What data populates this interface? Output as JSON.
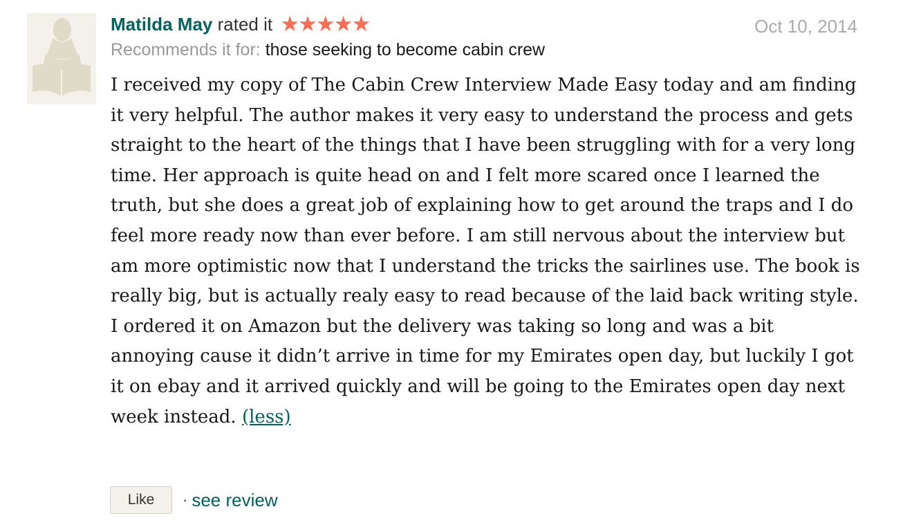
{
  "review": {
    "reviewer_name": "Matilda May",
    "rated_text": "rated it",
    "rating": 5,
    "rating_max": 5,
    "stars_display": "★★★★★",
    "date": "Oct 10, 2014",
    "recommends_label": "Recommends it for:",
    "recommends_value": "those seeking to become cabin crew",
    "body": "I received my copy of The Cabin Crew Interview Made Easy today and am finding it very helpful. The author makes it very easy to understand the process and gets straight to the heart of the things that I have been struggling with for a very long time. Her approach is quite head on and I felt more scared once I learned the truth, but she does a great job of explaining how to get around the traps and I do feel more ready now than ever before. I am still nervous about the interview but am more optimistic now that I understand the tricks the sairlines use. The book is really big, but is actually realy easy to read because of the laid back writing style. I ordered it on Amazon but the delivery was taking so long and was a bit annoying cause it didn’t arrive in time for my Emirates open day, but luckily I got it on ebay and it arrived quickly and will be going to the Emirates open day next week instead.",
    "less_label": "(less)",
    "like_label": "Like",
    "separator": "·",
    "see_review_label": "see review",
    "avatar_icon": "user-reading-book-silhouette-icon",
    "star_icon": "star-icon"
  },
  "colors": {
    "link": "#00635d",
    "star": "#fb6d53",
    "muted": "#999999",
    "date": "#aaaaaa",
    "avatar_bg": "#f4f1ea",
    "avatar_figure": "#e0dac8"
  }
}
